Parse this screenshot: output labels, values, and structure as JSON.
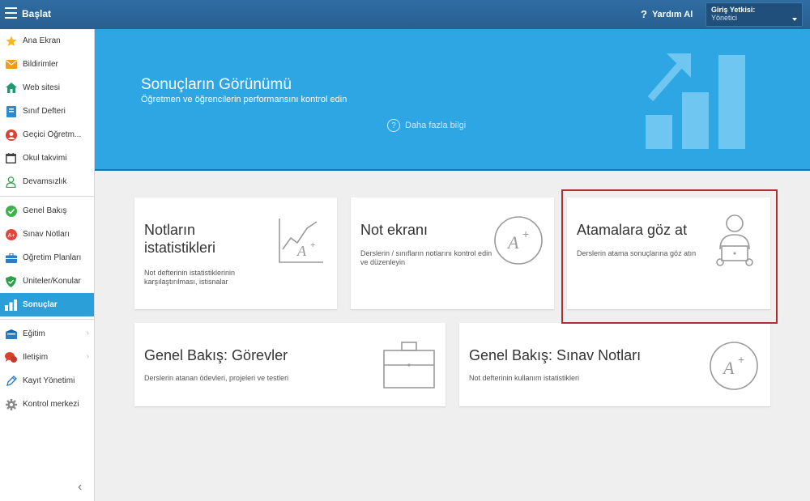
{
  "topbar": {
    "title": "Başlat",
    "help_label": "Yardım Al",
    "help_icon": "?",
    "role_label": "Giriş Yetkisi:",
    "role_value": "Yönetici"
  },
  "sidebar": {
    "items": [
      {
        "label": "Ana Ekran",
        "icon": "star-icon"
      },
      {
        "label": "Bildirimler",
        "icon": "envelope-icon"
      },
      {
        "label": "Web sitesi",
        "icon": "house-icon"
      },
      {
        "label": "Sınıf Defteri",
        "icon": "book-icon"
      },
      {
        "label": "Geçici Öğretm...",
        "icon": "person-icon"
      },
      {
        "label": "Okul takvimi",
        "icon": "calendar-icon"
      },
      {
        "label": "Devamsızlık",
        "icon": "user-outline-icon"
      },
      {
        "label": "Genel Bakış",
        "icon": "check-circle-icon"
      },
      {
        "label": "Sınav Notları",
        "icon": "grade-icon"
      },
      {
        "label": "Öğretim Planları",
        "icon": "briefcase-icon"
      },
      {
        "label": "Üniteler/Konular",
        "icon": "shield-icon"
      },
      {
        "label": "Sonuçlar",
        "icon": "bar-chart-icon"
      },
      {
        "label": "Eğitim",
        "icon": "education-icon"
      },
      {
        "label": "İletişim",
        "icon": "chat-icon"
      },
      {
        "label": "Kayıt Yönetimi",
        "icon": "pen-icon"
      },
      {
        "label": "Kontrol merkezi",
        "icon": "gear-icon"
      }
    ]
  },
  "hero": {
    "title": "Sonuçların Görünümü",
    "subtitle": "Öğretmen ve öğrencilerin performansını kontrol edin",
    "more_label": "Daha fazla bilgi"
  },
  "cards": [
    {
      "title": "Notların istatistikleri",
      "desc": "Not defterinin istatistiklerinin karşılaştırılması, istisnalar"
    },
    {
      "title": "Not ekranı",
      "desc": "Derslerin / sınıfların notlarını kontrol edin ve düzenleyin"
    },
    {
      "title": "Atamalara göz at",
      "desc": "Derslerin atama sonuçlarına göz atın"
    },
    {
      "title": "Genel Bakış: Görevler",
      "desc": "Derslerin atanan ödevleri, projeleri ve testleri"
    },
    {
      "title": "Genel Bakış: Sınav Notları",
      "desc": "Not defterinin kullanım istatistikleri"
    }
  ],
  "colors": {
    "topbar": "#2a6496",
    "hero": "#2fa6e4",
    "active_item": "#2a9fd8",
    "highlight": "#b03030"
  }
}
